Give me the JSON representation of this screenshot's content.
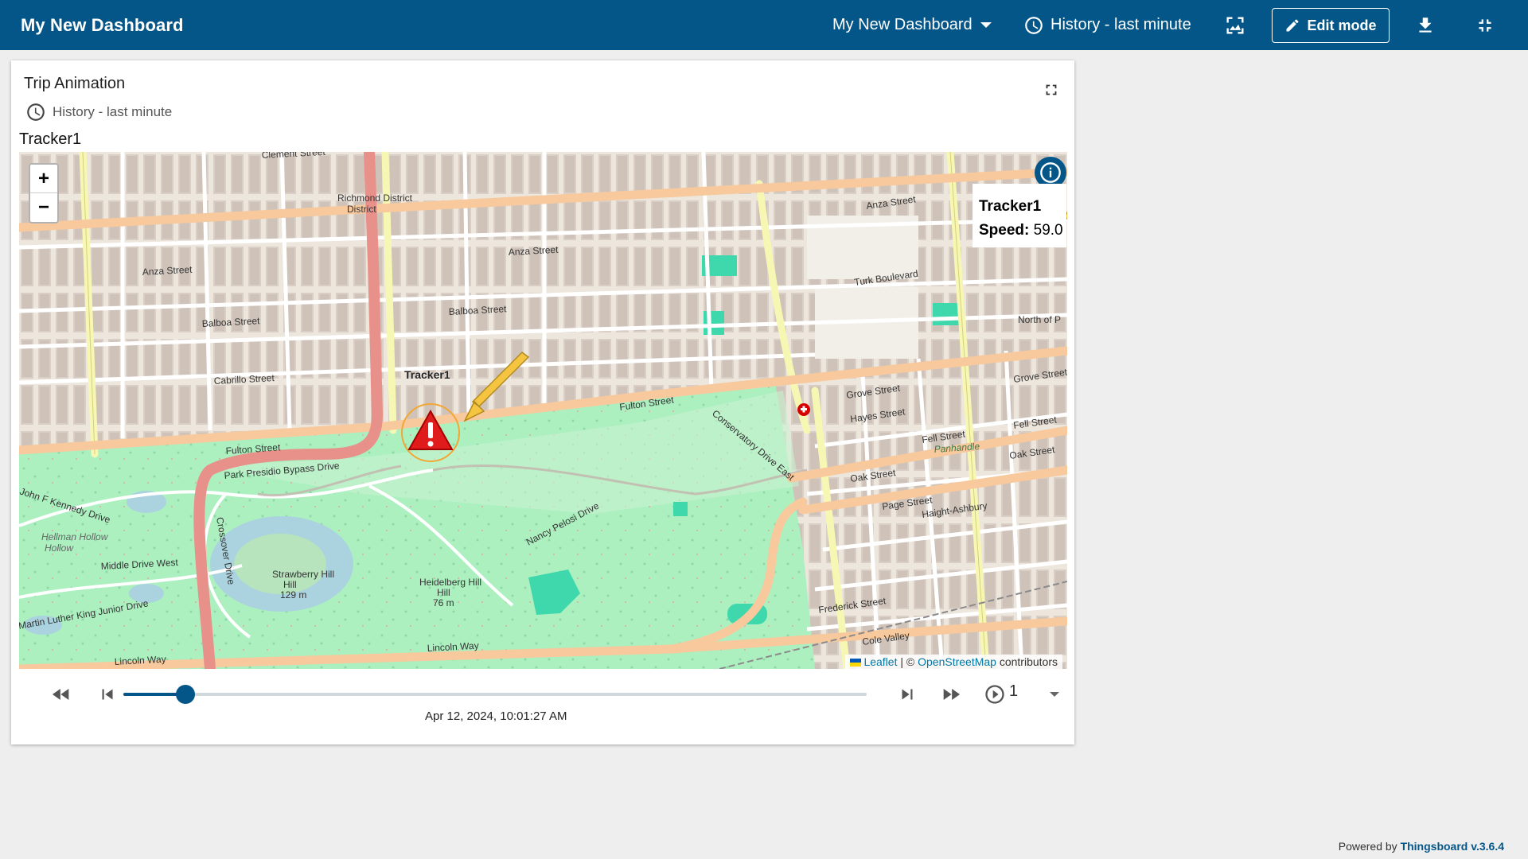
{
  "topbar": {
    "title": "My New Dashboard",
    "dashboard_select": "My New Dashboard",
    "timewindow": "History - last minute",
    "edit_label": "Edit mode",
    "icons": [
      "clock-icon",
      "image-export-icon",
      "pencil-icon",
      "download-icon",
      "fullscreen-exit-icon"
    ]
  },
  "widget": {
    "title": "Trip Animation",
    "timewindow": "History - last minute",
    "entity": "Tracker1"
  },
  "map": {
    "marker_label": "Tracker1",
    "tooltip": {
      "name": "Tracker1",
      "speed_label": "Speed:",
      "speed_value": "59.0"
    },
    "attribution": {
      "leaflet": "Leaflet",
      "sep": " | © ",
      "osm": "OpenStreetMap",
      "suffix": " contributors"
    },
    "street_labels": [
      "Fulton Street",
      "Park Presidio Bypass Drive",
      "Balboa Street",
      "Cabrillo Street",
      "Anza Street",
      "Turk Boulevard",
      "Fell Street",
      "Oak Street",
      "Lincoln Way",
      "Crossover Drive",
      "Richmond District",
      "Haight-Ashbury",
      "Page Street",
      "Frederick Street",
      "Cole Valley",
      "Nancy Pelosi Drive",
      "Strawberry Hill",
      "129 m",
      "Heidelberg Hill",
      "76 m",
      "Panhandle",
      "Hellman Hollow",
      "John F Kennedy Drive",
      "Middle Drive West",
      "Martin Luther King Junior Drive",
      "Grove Street",
      "Hayes Street",
      "North of P",
      "Clement Street",
      "Conservatory Drive East"
    ]
  },
  "player": {
    "timestamp": "Apr 12, 2024, 10:01:27 AM",
    "progress": 0.083,
    "speed_multiplier": "1"
  },
  "footer": {
    "powered_by": "Powered by ",
    "brand": "Thingsboard v.3.6.4"
  },
  "colors": {
    "primary": "#035687",
    "park": "#acf0c0",
    "road_major": "#f7c99d",
    "road_trunk": "#e8918a",
    "road_secondary": "#f7f7b4",
    "water": "#aad3df"
  }
}
